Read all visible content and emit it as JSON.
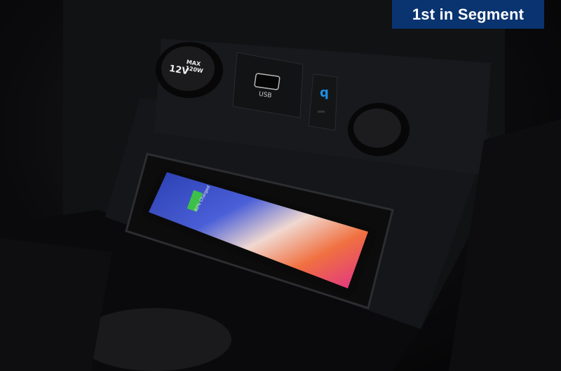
{
  "badge": {
    "label": "1st in Segment",
    "color": "#0a3470"
  },
  "socket_left": {
    "voltage": "12V",
    "rating_line1": "MAX",
    "rating_line2": "120W"
  },
  "usb_port": {
    "label": "USB"
  },
  "wireless_charging_indicator": {
    "icon": "qi-icon",
    "color": "#1e8fe6"
  },
  "phone": {
    "status_text": "82% Charged",
    "battery_level_percent": 82,
    "battery_color": "#3cc04a"
  }
}
